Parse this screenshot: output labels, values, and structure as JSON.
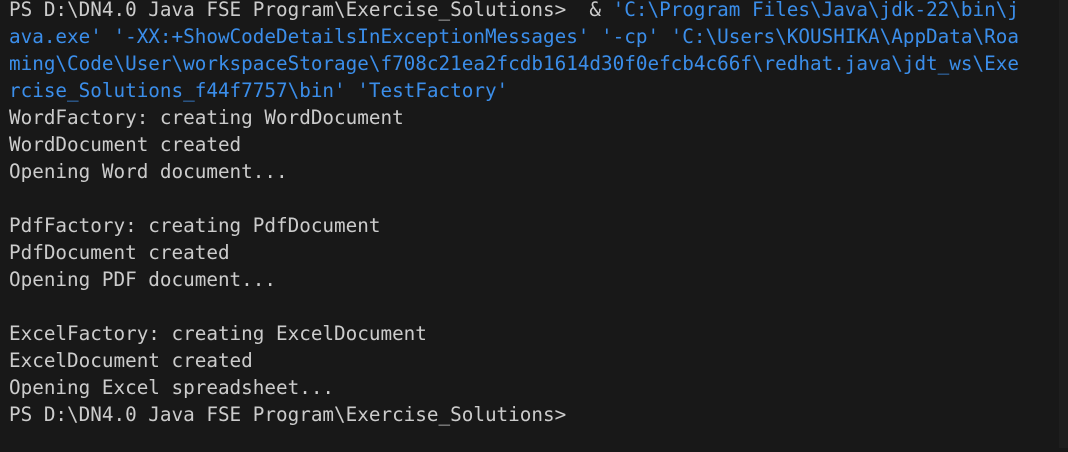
{
  "terminal": {
    "prompt": "PS D:\\DN4.0 Java FSE Program\\Exercise_Solutions>",
    "amp": "&",
    "command_lines": [
      "'C:\\Program Files\\Java\\jdk-22\\bin\\j",
      "ava.exe' '-XX:+ShowCodeDetailsInExceptionMessages' '-cp' 'C:\\Users\\KOUSHIKA\\AppData\\Roa",
      "ming\\Code\\User\\workspaceStorage\\f708c21ea2fcdb1614d30f0efcb4c66f\\redhat.java\\jdt_ws\\Exe",
      "rcise_Solutions_f44f7757\\bin' 'TestFactory'"
    ],
    "output": [
      "WordFactory: creating WordDocument",
      "WordDocument created",
      "Opening Word document...",
      "",
      "PdfFactory: creating PdfDocument",
      "PdfDocument created",
      "Opening PDF document...",
      "",
      "ExcelFactory: creating ExcelDocument",
      "ExcelDocument created",
      "Opening Excel spreadsheet..."
    ],
    "final_prompt": "PS D:\\DN4.0 Java FSE Program\\Exercise_Solutions>",
    "colors": {
      "background": "#181818",
      "text": "#cccccc",
      "command": "#3b8eea"
    }
  }
}
